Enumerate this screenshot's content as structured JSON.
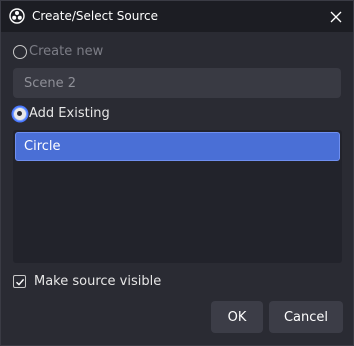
{
  "window": {
    "title": "Create/Select Source"
  },
  "options": {
    "create_new_label": "Create new",
    "create_new_selected": false,
    "name_value": "Scene 2",
    "add_existing_label": "Add Existing",
    "add_existing_selected": true
  },
  "existing_sources": [
    {
      "label": "Circle",
      "selected": true
    }
  ],
  "make_visible": {
    "label": "Make source visible",
    "checked": true
  },
  "buttons": {
    "ok_label": "OK",
    "cancel_label": "Cancel"
  },
  "colors": {
    "accent": "#4a6fd6",
    "window_bg": "#2a2b33",
    "titlebar_bg": "#1c1d23"
  },
  "icons": {
    "app": "obs-icon",
    "close": "close-icon",
    "check": "checkmark-icon"
  }
}
